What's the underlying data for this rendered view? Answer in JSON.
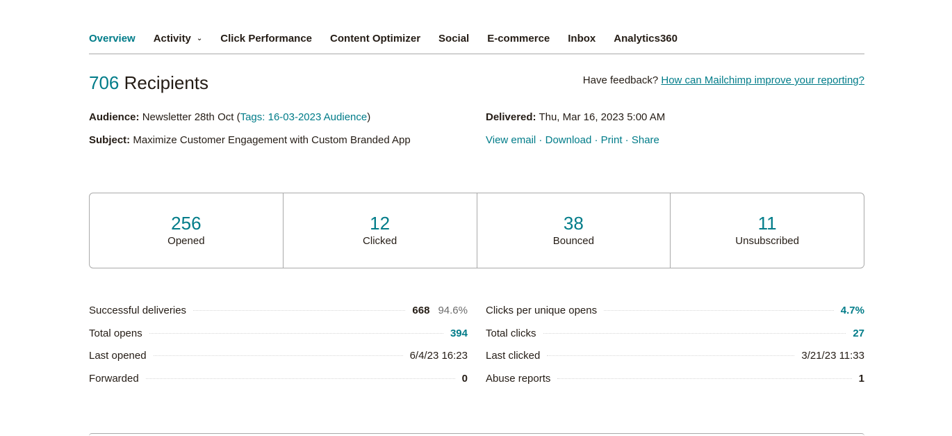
{
  "tabs": [
    {
      "label": "Overview",
      "active": true
    },
    {
      "label": "Activity",
      "active": false,
      "dropdown": true
    },
    {
      "label": "Click Performance",
      "active": false
    },
    {
      "label": "Content Optimizer",
      "active": false
    },
    {
      "label": "Social",
      "active": false
    },
    {
      "label": "E-commerce",
      "active": false
    },
    {
      "label": "Inbox",
      "active": false
    },
    {
      "label": "Analytics360",
      "active": false
    }
  ],
  "header": {
    "recipients_count": "706",
    "recipients_label": "Recipients",
    "feedback_prefix": "Have feedback?",
    "feedback_link": "How can Mailchimp improve your reporting?"
  },
  "details": {
    "audience_label": "Audience:",
    "audience_value": "Newsletter 28th Oct",
    "tags_open": " (",
    "tags_value": "Tags: 16-03-2023 Audience",
    "tags_close": ")",
    "subject_label": "Subject:",
    "subject_value": "Maximize Customer Engagement with Custom Branded App",
    "delivered_label": "Delivered:",
    "delivered_value": "Thu, Mar 16, 2023 5:00 AM",
    "actions": [
      "View email",
      "Download",
      "Print",
      "Share"
    ],
    "separator": " · "
  },
  "stats": [
    {
      "value": "256",
      "label": "Opened"
    },
    {
      "value": "12",
      "label": "Clicked"
    },
    {
      "value": "38",
      "label": "Bounced"
    },
    {
      "value": "11",
      "label": "Unsubscribed"
    }
  ],
  "metrics_left": [
    {
      "label": "Successful deliveries",
      "value": "668",
      "pct": "94.6%"
    },
    {
      "label": "Total opens",
      "value": "394"
    },
    {
      "label": "Last opened",
      "value": "6/4/23 16:23"
    },
    {
      "label": "Forwarded",
      "value": "0"
    }
  ],
  "metrics_right": [
    {
      "label": "Clicks per unique opens",
      "value": "4.7%"
    },
    {
      "label": "Total clicks",
      "value": "27"
    },
    {
      "label": "Last clicked",
      "value": "3/21/23 11:33"
    },
    {
      "label": "Abuse reports",
      "value": "1"
    }
  ],
  "colors": {
    "accent": "#007c89",
    "text": "#241c15",
    "border": "#a9a9a9"
  }
}
